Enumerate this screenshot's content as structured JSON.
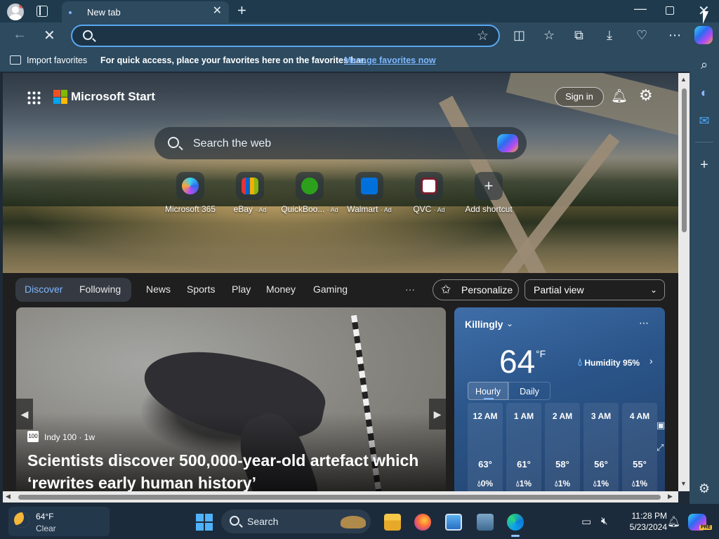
{
  "browser": {
    "tab_title": "New tab",
    "new_tab_symbol": "+",
    "address_placeholder": "",
    "favorites_bar": {
      "import_label": "Import favorites",
      "message": "For quick access, place your favorites here on the favorites bar.",
      "manage_link": "Manage favorites now"
    }
  },
  "msn": {
    "brand": "Microsoft Start",
    "sign_in": "Sign in",
    "search_placeholder": "Search the web",
    "shortcuts": [
      {
        "label": "Microsoft 365",
        "ad": ""
      },
      {
        "label": "eBay",
        "ad": "· Ad"
      },
      {
        "label": "QuickBoo...",
        "ad": "· Ad"
      },
      {
        "label": "Walmart",
        "ad": "· Ad"
      },
      {
        "label": "QVC",
        "ad": "· Ad"
      },
      {
        "label": "Add shortcut",
        "ad": ""
      }
    ],
    "feed_tabs": {
      "discover": "Discover",
      "following": "Following",
      "news": "News",
      "sports": "Sports",
      "play": "Play",
      "money": "Money",
      "gaming": "Gaming",
      "more": "···"
    },
    "personalize": "Personalize",
    "view_select": "Partial view",
    "hero_story": {
      "source_logo": "100",
      "source": "Indy 100 · 1w",
      "headline": "Scientists discover 500,000-year-old artefact which ‘rewrites early human history’"
    },
    "weather": {
      "city": "Killingly",
      "temp": "64",
      "unit": "°F",
      "humidity": "Humidity 95%",
      "tab_hourly": "Hourly",
      "tab_daily": "Daily",
      "hours": [
        {
          "time": "12 AM",
          "temp": "63°",
          "precip": "0%"
        },
        {
          "time": "1 AM",
          "temp": "61°",
          "precip": "1%"
        },
        {
          "time": "2 AM",
          "temp": "58°",
          "precip": "1%"
        },
        {
          "time": "3 AM",
          "temp": "56°",
          "precip": "1%"
        },
        {
          "time": "4 AM",
          "temp": "55°",
          "precip": "1%"
        }
      ]
    }
  },
  "taskbar": {
    "weather_temp": "64°F",
    "weather_cond": "Clear",
    "search_label": "Search",
    "time": "11:28 PM",
    "date": "5/23/2024",
    "pre_badge": "PRE"
  },
  "colors": {
    "accent": "#7db7ff",
    "chrome": "#2d4a5f",
    "weather_card": "#2b568b"
  }
}
